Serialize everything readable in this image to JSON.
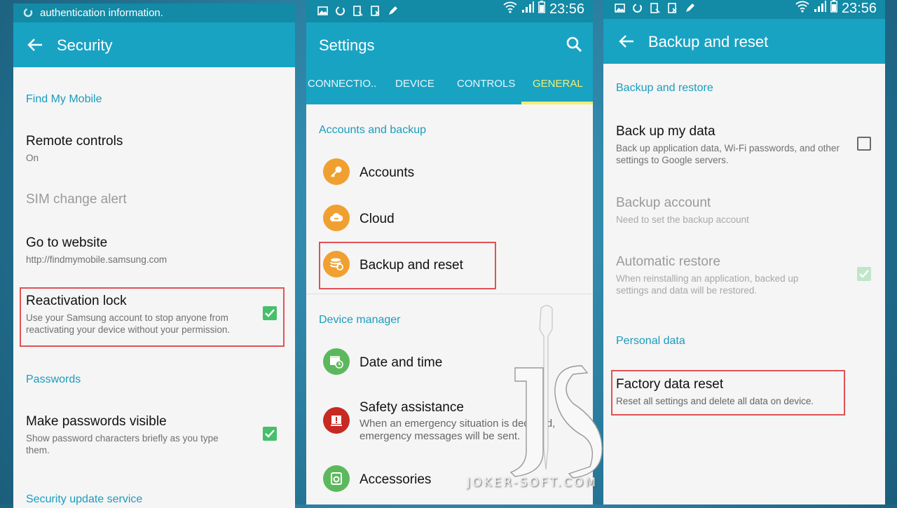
{
  "colors": {
    "appbar": "#19a3c3",
    "statusbar": "#138aa6",
    "accent": "#1a9cbd",
    "highlight": "#e05254",
    "check": "#46bf6b"
  },
  "security": {
    "status_text": "authentication information.",
    "title": "Security",
    "find_my_mobile": "Find My Mobile",
    "remote_controls": {
      "title": "Remote controls",
      "sub": "On"
    },
    "sim_change_alert": "SIM change alert",
    "go_to_website": {
      "title": "Go to website",
      "sub": "http://findmymobile.samsung.com"
    },
    "reactivation_lock": {
      "title": "Reactivation lock",
      "sub": "Use your Samsung account to stop anyone from reactivating your device without your permission.",
      "checked": true
    },
    "passwords": "Passwords",
    "make_passwords_visible": {
      "title": "Make passwords visible",
      "sub": "Show password characters briefly as you type them.",
      "checked": true
    },
    "security_update_service": "Security update service"
  },
  "settings": {
    "time": "23:56",
    "title": "Settings",
    "tabs": [
      "CONNECTIO..",
      "DEVICE",
      "CONTROLS",
      "GENERAL"
    ],
    "active_tab": "GENERAL",
    "accounts_and_backup": "Accounts and backup",
    "items": {
      "accounts": "Accounts",
      "cloud": "Cloud",
      "backup_and_reset": "Backup and reset"
    },
    "device_manager": "Device manager",
    "date_and_time": "Date and time",
    "safety_assistance": {
      "title": "Safety assistance",
      "sub": "When an emergency situation is declared, emergency messages will be sent."
    },
    "accessories": "Accessories"
  },
  "backup": {
    "time": "23:56",
    "title": "Backup and reset",
    "backup_and_restore": "Backup and restore",
    "back_up_my_data": {
      "title": "Back up my data",
      "sub": "Back up application data, Wi-Fi passwords, and other settings to Google servers.",
      "checked": false
    },
    "backup_account": {
      "title": "Backup account",
      "sub": "Need to set the backup account"
    },
    "automatic_restore": {
      "title": "Automatic restore",
      "sub": "When reinstalling an application, backed up settings and data will be restored.",
      "checked": true
    },
    "personal_data": "Personal data",
    "factory_data_reset": {
      "title": "Factory data reset",
      "sub": "Reset all settings and delete all data on device."
    }
  },
  "watermark": "JOKER-SOFT.COM"
}
